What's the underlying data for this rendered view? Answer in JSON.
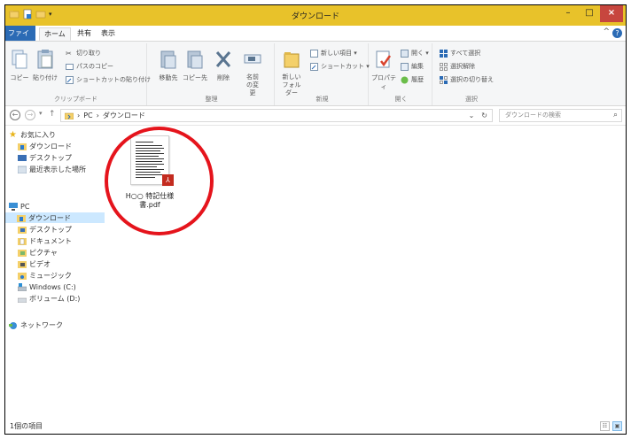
{
  "window": {
    "title": "ダウンロード",
    "min_glyph": "–",
    "max_glyph": "□",
    "close_glyph": "×"
  },
  "ribbon_tabs": {
    "file": "ファイル",
    "home": "ホーム",
    "share": "共有",
    "view": "表示",
    "help": "?",
    "collapse": "^"
  },
  "ribbon": {
    "clipboard": {
      "label": "クリップボード",
      "copy": "コピー",
      "paste": "貼り付け",
      "cut": "切り取り",
      "copy_path": "パスのコピー",
      "paste_shortcut": "ショートカットの貼り付け"
    },
    "organize": {
      "label": "整理",
      "move_to": "移動先",
      "copy_to": "コピー先",
      "delete": "削除",
      "rename": "名前の変更"
    },
    "new": {
      "label": "新規",
      "new_folder": "新しいフォルダー",
      "new_item": "新しい項目 ▾",
      "shortcut": "ショートカット ▾"
    },
    "open": {
      "label": "開く",
      "properties": "プロパティ",
      "open": "開く ▾",
      "edit": "編集",
      "history": "履歴"
    },
    "select": {
      "label": "選択",
      "select_all": "すべて選択",
      "select_none": "選択解除",
      "invert": "選択の切り替え"
    }
  },
  "address": {
    "back": "←",
    "forward": "→",
    "history": "▾",
    "up": "↑",
    "crumb_sep": "›",
    "crumbs": [
      "PC",
      "ダウンロード"
    ],
    "dropdown": "⌄",
    "refresh": "↻",
    "search_placeholder": "ダウンロードの検索",
    "search_icon": "⌕"
  },
  "nav": {
    "favorites": "お気に入り",
    "fav_items": [
      "ダウンロード",
      "デスクトップ",
      "最近表示した場所"
    ],
    "pc": "PC",
    "pc_items": [
      "ダウンロード",
      "デスクトップ",
      "ドキュメント",
      "ピクチャ",
      "ビデオ",
      "ミュージック",
      "Windows (C:)",
      "ボリューム (D:)"
    ],
    "network": "ネットワーク"
  },
  "file": {
    "name_line1": "H○○ 特記仕様",
    "name_line2": "書.pdf",
    "badge": "⅄"
  },
  "status": {
    "count": "1個の項目",
    "details_view": "☷",
    "icons_view": "▣"
  },
  "colors": {
    "titlebar": "#e8c22a",
    "file_tab": "#2b6bb5",
    "selection": "#cce8ff",
    "highlight_circle": "#e5141c",
    "pdf_badge": "#c32b1f"
  }
}
